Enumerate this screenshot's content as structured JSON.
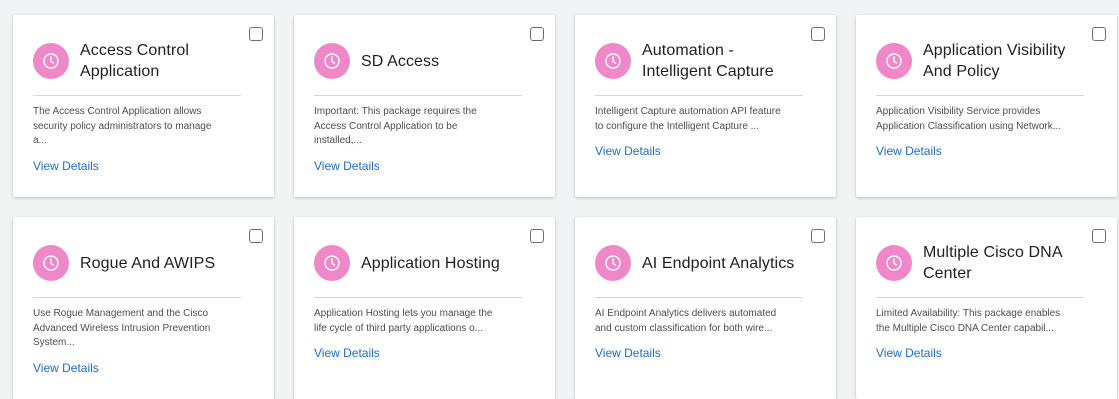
{
  "cards": [
    {
      "title": "Access Control\nApplication",
      "description": "The Access Control Application allows\nsecurity policy administrators to manage\na...",
      "link": "View Details",
      "icon": "clock-icon"
    },
    {
      "title": "SD Access",
      "description": "Important: This package requires the\nAccess Control Application to be\ninstalled,...",
      "link": "View Details",
      "icon": "clock-icon"
    },
    {
      "title": "Automation -\nIntelligent Capture",
      "description": "Intelligent Capture automation API feature\nto configure the Intelligent Capture ...",
      "link": "View Details",
      "icon": "clock-icon"
    },
    {
      "title": "Application Visibility\nAnd Policy",
      "description": "Application Visibility Service provides\nApplication Classification using Network...",
      "link": "View Details",
      "icon": "clock-icon"
    },
    {
      "title": "Rogue And AWIPS",
      "description": "Use Rogue Management and the Cisco\nAdvanced Wireless Intrusion Prevention\nSystem...",
      "link": "View Details",
      "icon": "clock-icon"
    },
    {
      "title": "Application Hosting",
      "description": "Application Hosting lets you manage the\nlife cycle of third party applications o...",
      "link": "View Details",
      "icon": "clock-icon"
    },
    {
      "title": "AI Endpoint Analytics",
      "description": "AI Endpoint Analytics delivers automated\nand custom classification for both wire...",
      "link": "View Details",
      "icon": "clock-icon"
    },
    {
      "title": "Multiple Cisco DNA\nCenter",
      "description": "Limited Availability: This package enables\nthe Multiple Cisco DNA Center capabil...",
      "link": "View Details",
      "icon": "clock-icon"
    }
  ],
  "colors": {
    "icon_bg": "#ee88c8",
    "link": "#1a6fc4"
  }
}
